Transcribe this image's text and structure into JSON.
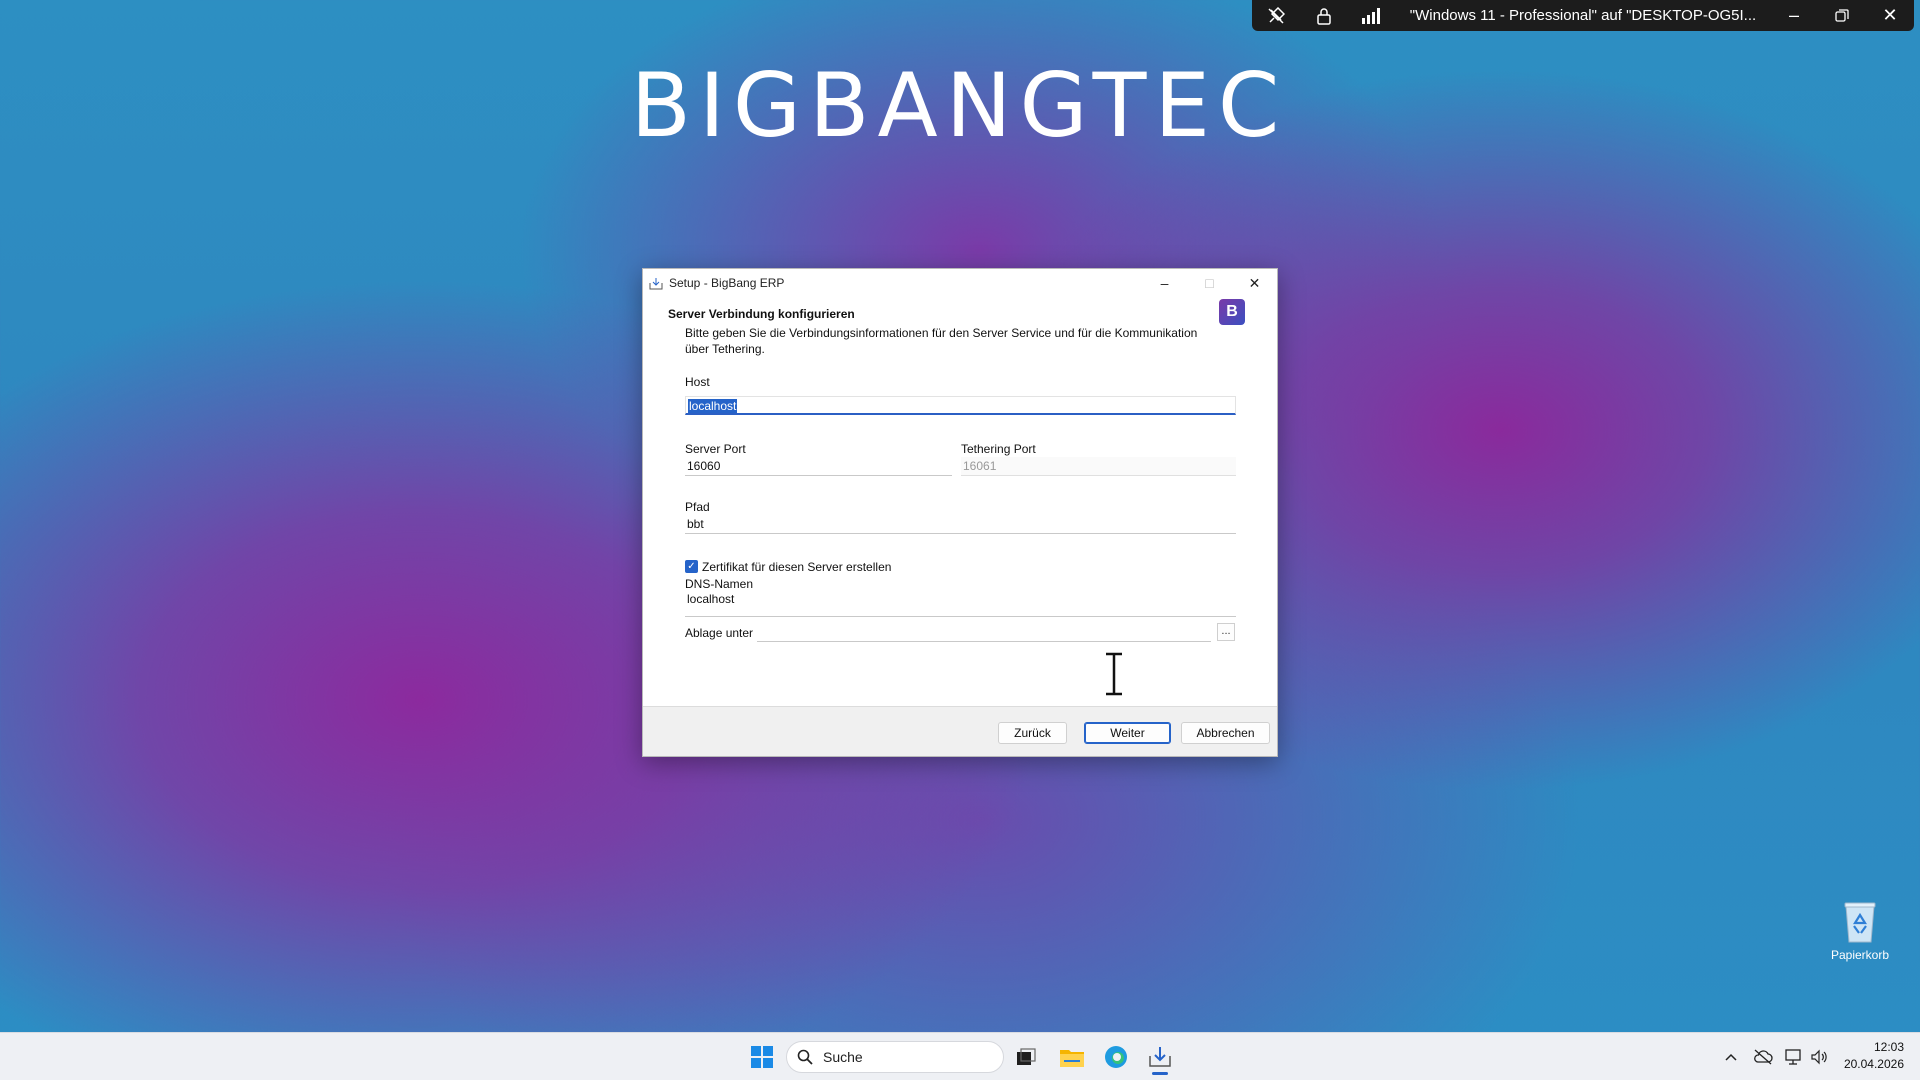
{
  "remote_bar": {
    "session_title": "\"Windows 11 - Professional\" auf \"DESKTOP-OG5I...",
    "icons": [
      "unpin-icon",
      "lock-icon",
      "signal-bars-icon"
    ],
    "controls": [
      "minimize-icon",
      "restore-icon",
      "close-icon"
    ]
  },
  "wallpaper": {
    "logo_text": "BIGBANGTEC"
  },
  "dialog": {
    "title": "Setup - BigBang ERP",
    "brand_badge": "B",
    "heading": "Server Verbindung konfigurieren",
    "description": "Bitte geben Sie die Verbindungsinformationen für den Server Service und für die Kommunikation über Tethering.",
    "host": {
      "label": "Host",
      "value": "localhost"
    },
    "server_port": {
      "label": "Server Port",
      "value": "16060"
    },
    "tethering_port": {
      "label": "Tethering Port",
      "value": "16061"
    },
    "path": {
      "label": "Pfad",
      "value": "bbt"
    },
    "certificate": {
      "label": "Zertifikat für diesen Server erstellen",
      "checked": true
    },
    "dns_names": {
      "label": "DNS-Namen",
      "value": "localhost"
    },
    "storage": {
      "label": "Ablage unter",
      "value": "",
      "browse_label": "..."
    },
    "buttons": {
      "back": "Zurück",
      "next": "Weiter",
      "cancel": "Abbrechen"
    }
  },
  "desktop": {
    "recycle_bin_label": "Papierkorb"
  },
  "taskbar": {
    "search_placeholder": "Suche",
    "time": "12:03",
    "date": "20.04.2026",
    "accent_color": "#2563c9"
  }
}
